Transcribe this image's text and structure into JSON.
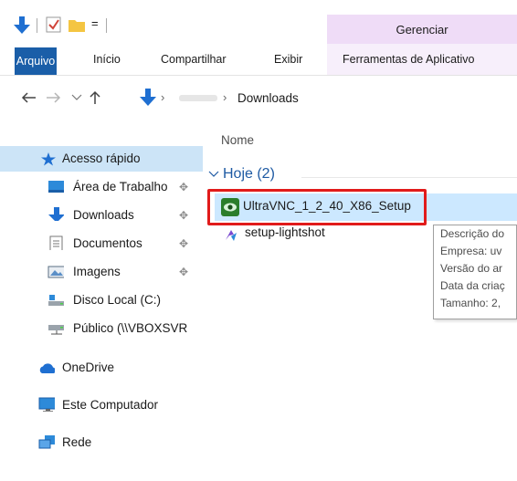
{
  "titlebar": {
    "contextual_tab": "Gerenciar",
    "quick_access_dropdown": "="
  },
  "ribbon": {
    "tabs": [
      "Arquivo",
      "Início",
      "Compartilhar",
      "Exibir",
      "Ferramentas de Aplicativo"
    ]
  },
  "address": {
    "current_folder": "Downloads"
  },
  "nav": {
    "quick_access": "Acesso rápido",
    "items": [
      {
        "label": "Área de Trabalho",
        "icon": "desktop-icon"
      },
      {
        "label": "Downloads",
        "icon": "download-arrow-icon"
      },
      {
        "label": "Documentos",
        "icon": "document-icon"
      },
      {
        "label": "Imagens",
        "icon": "pictures-icon"
      },
      {
        "label": "Disco Local (C:)",
        "icon": "drive-icon"
      },
      {
        "label": "Público (\\\\VBOXSVR",
        "icon": "network-drive-icon"
      }
    ],
    "onedrive": "OneDrive",
    "this_pc": "Este Computador",
    "network": "Rede"
  },
  "content": {
    "column_name": "Nome",
    "group": "Hoje (2)",
    "files": [
      {
        "name": "UltraVNC_1_2_40_X86_Setup",
        "icon": "ultravnc-icon"
      },
      {
        "name": "setup-lightshot",
        "icon": "lightshot-icon"
      }
    ]
  },
  "tooltip": {
    "lines": [
      "Descrição do",
      "Empresa: uv",
      "Versão do ar",
      "Data da criaç",
      "Tamanho: 2,"
    ]
  },
  "colors": {
    "accent": "#1a5ea8",
    "selection": "#cce8ff",
    "highlight_box": "#e11b1b",
    "contextual_tab": "#efdcf7"
  }
}
